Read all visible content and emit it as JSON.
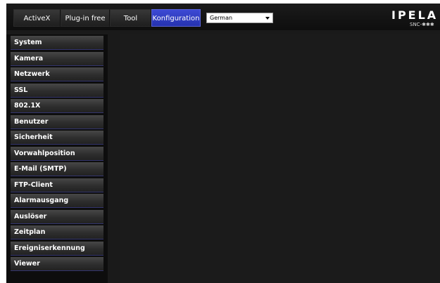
{
  "topbar": {
    "tabs": [
      {
        "label": "ActiveX"
      },
      {
        "label": "Plug-in free"
      },
      {
        "label": "Tool"
      },
      {
        "label": "Konfiguration"
      }
    ],
    "language_select": {
      "value": "German"
    },
    "brand": {
      "logo": "IPELA",
      "model": "SNC-✱✱✱"
    }
  },
  "sidebar": {
    "items": [
      {
        "label": "System"
      },
      {
        "label": "Kamera"
      },
      {
        "label": "Netzwerk"
      },
      {
        "label": "SSL"
      },
      {
        "label": "802.1X"
      },
      {
        "label": "Benutzer"
      },
      {
        "label": "Sicherheit"
      },
      {
        "label": "Vorwahlposition"
      },
      {
        "label": "E-Mail (SMTP)"
      },
      {
        "label": "FTP-Client"
      },
      {
        "label": "Alarmausgang"
      },
      {
        "label": "Auslöser"
      },
      {
        "label": "Zeitplan"
      },
      {
        "label": "Ereigniserkennung"
      },
      {
        "label": "Viewer"
      }
    ]
  },
  "colors": {
    "background": "#1a1a1a",
    "active_tab": "#2f3cc4",
    "menu_separator": "#33356e"
  }
}
